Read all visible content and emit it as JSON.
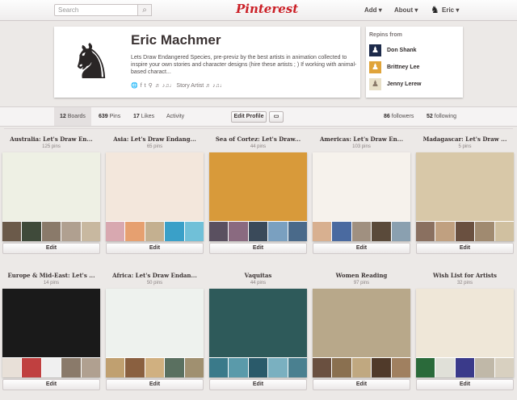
{
  "header": {
    "search_placeholder": "Search",
    "search_icon": "search-icon",
    "logo": "Pinterest",
    "add_label": "Add ▾",
    "about_label": "About ▾",
    "user_label": "Eric ▾"
  },
  "profile": {
    "name": "Eric Machmer",
    "bio": "Lets Draw Endangered Species, pre-previz by the best artists in animation collected to inspire your own stories and character designs (hire these artists ; ) If working with animal-based charact...",
    "tagline": "♬ ♪♫♩ Story Artist ♬ ♪♫♩"
  },
  "repins": {
    "title": "Repins from",
    "users": [
      {
        "name": "Don Shank",
        "color": "#1d2a4a"
      },
      {
        "name": "Brittney Lee",
        "color": "#e0a43a"
      },
      {
        "name": "Jenny Lerew",
        "color": "#e8e0c8"
      }
    ]
  },
  "stats": {
    "boards_count": "12",
    "boards_label": "Boards",
    "pins_count": "639",
    "pins_label": "Pins",
    "likes_count": "17",
    "likes_label": "Likes",
    "activity_label": "Activity",
    "edit_profile": "Edit Profile",
    "followers_count": "86",
    "followers_label": "followers",
    "following_count": "52",
    "following_label": "following"
  },
  "boards": [
    {
      "title": "Australia: Let's Draw En...",
      "pins": "125 pins",
      "edit": "Edit",
      "cover": "#eef0e4",
      "thumbs": [
        "#6b5a4a",
        "#3f4a3a",
        "#8a7a6a",
        "#b0a090",
        "#c8b8a0"
      ]
    },
    {
      "title": "Asia: Let's Draw Endang...",
      "pins": "65 pins",
      "edit": "Edit",
      "cover": "#f3e7dc",
      "thumbs": [
        "#d8a8b0",
        "#e6a070",
        "#c4b090",
        "#3aa0c8",
        "#70c0d8"
      ]
    },
    {
      "title": "Sea of Cortez: Let's Draw...",
      "pins": "44 pins",
      "edit": "Edit",
      "cover": "#d89a3a",
      "thumbs": [
        "#5a5060",
        "#8a6a80",
        "#3a4a5a",
        "#7aa0c0",
        "#4a6a8a"
      ]
    },
    {
      "title": "Americas: Let's Draw En...",
      "pins": "103 pins",
      "edit": "Edit",
      "cover": "#f6f2ec",
      "thumbs": [
        "#d8b090",
        "#4a6aa0",
        "#a09080",
        "#5a4a3a",
        "#8aa0b0"
      ]
    },
    {
      "title": "Madagascar: Let's Draw ...",
      "pins": "5 pins",
      "edit": "Edit",
      "cover": "#d8c8a8",
      "thumbs": [
        "#8a7060",
        "#c0a080",
        "#6a5040",
        "#a08a70",
        "#d0c0a0"
      ]
    },
    {
      "title": "Europe & Mid-East: Let's ...",
      "pins": "14 pins",
      "edit": "Edit",
      "cover": "#1a1a1a",
      "thumbs": [
        "#e8e0d8",
        "#c04040",
        "#f0f0f0",
        "#8a7a6a",
        "#b0a090"
      ]
    },
    {
      "title": "Africa: Let's Draw Endan...",
      "pins": "50 pins",
      "edit": "Edit",
      "cover": "#eef2ee",
      "thumbs": [
        "#c0a070",
        "#8a6040",
        "#d0b080",
        "#5a7060",
        "#a09070"
      ]
    },
    {
      "title": "Vaquitas",
      "pins": "44 pins",
      "edit": "Edit",
      "cover": "#2e5a5a",
      "thumbs": [
        "#3a7a8a",
        "#5a9aaa",
        "#2a5a6a",
        "#7ab0c0",
        "#4a8090"
      ]
    },
    {
      "title": "Women Reading",
      "pins": "97 pins",
      "edit": "Edit",
      "cover": "#b8a88a",
      "thumbs": [
        "#6a5040",
        "#8a7050",
        "#c0a880",
        "#503a2a",
        "#a08060"
      ]
    },
    {
      "title": "Wish List for Artists",
      "pins": "32 pins",
      "edit": "Edit",
      "cover": "#efe7d8",
      "thumbs": [
        "#2a6a3a",
        "#e0e0d8",
        "#3a3a8a",
        "#c0b8a8",
        "#d8d0c0"
      ]
    }
  ]
}
